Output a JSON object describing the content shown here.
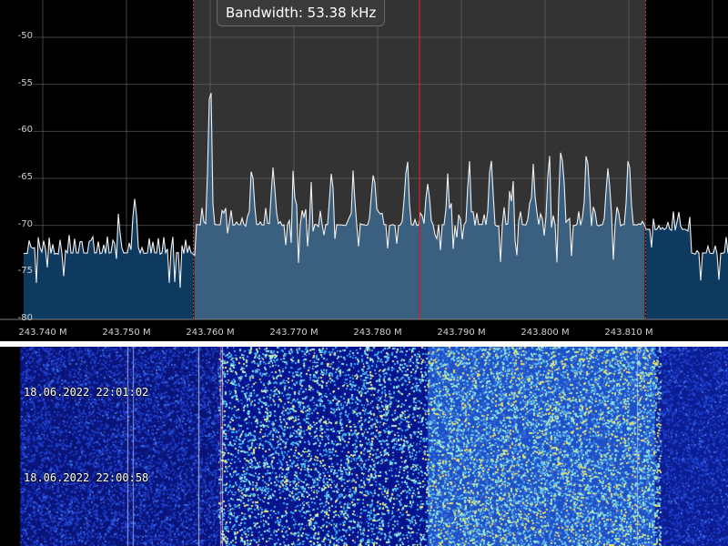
{
  "bandwidth_label": "Bandwidth: 53.38 kHz",
  "spectrum": {
    "y_ticks": [
      "-50",
      "-55",
      "-60",
      "-65",
      "-70",
      "-75",
      "-80"
    ],
    "x_ticks": [
      "243.740 M",
      "243.750 M",
      "243.760 M",
      "243.770 M",
      "243.780 M",
      "243.790 M",
      "243.800 M",
      "243.810 M"
    ]
  },
  "chart_data": {
    "type": "area",
    "x_unit": "MHz",
    "ylim": [
      -80,
      -46
    ],
    "xlim": [
      243.737,
      243.7713
    ],
    "grid": true,
    "filter_band_mhz": [
      243.758,
      243.812
    ],
    "center_mhz": 243.785,
    "peaks": [
      {
        "x": 243.7395,
        "y": -72
      },
      {
        "x": 243.749,
        "y": -69
      },
      {
        "x": 243.751,
        "y": -67
      },
      {
        "x": 243.76,
        "y": -55
      },
      {
        "x": 243.762,
        "y": -68
      },
      {
        "x": 243.765,
        "y": -64
      },
      {
        "x": 243.7675,
        "y": -64
      },
      {
        "x": 243.77,
        "y": -63
      },
      {
        "x": 243.772,
        "y": -65
      },
      {
        "x": 243.7745,
        "y": -64
      },
      {
        "x": 243.777,
        "y": -64
      },
      {
        "x": 243.7795,
        "y": -64
      },
      {
        "x": 243.7835,
        "y": -63
      },
      {
        "x": 243.786,
        "y": -65
      },
      {
        "x": 243.7885,
        "y": -64
      },
      {
        "x": 243.791,
        "y": -63
      },
      {
        "x": 243.7935,
        "y": -63
      },
      {
        "x": 243.796,
        "y": -64
      },
      {
        "x": 243.7985,
        "y": -63
      },
      {
        "x": 243.8005,
        "y": -63
      },
      {
        "x": 243.802,
        "y": -60
      },
      {
        "x": 243.805,
        "y": -62
      },
      {
        "x": 243.8075,
        "y": -64
      },
      {
        "x": 243.81,
        "y": -63
      },
      {
        "x": 243.816,
        "y": -69
      }
    ],
    "noise_floor": [
      {
        "band": "outside",
        "y": -73
      },
      {
        "band": "inside",
        "y": -70
      }
    ]
  },
  "waterfall": {
    "timestamps": [
      "18.06.2022 22:01:02",
      "18.06.2022 22:00:58"
    ]
  }
}
